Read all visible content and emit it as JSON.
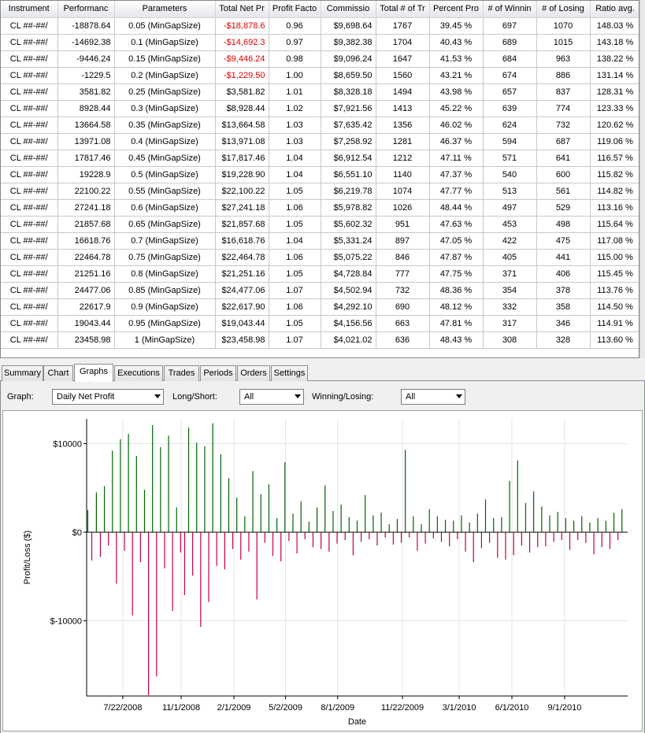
{
  "grid": {
    "columns": [
      "Instrument",
      "Performanc",
      "Parameters",
      "Total Net Pr",
      "Profit Facto",
      "Commissio",
      "Total # of Tr",
      "Percent Pro",
      "# of Winnin",
      "# of Losing",
      "Ratio avg."
    ],
    "rows": [
      [
        "CL ##-##/",
        "-18878.64",
        "0.05 (MinGapSize)",
        "-$18,878.6",
        "0.96",
        "$9,698.64",
        "1767",
        "39.45 %",
        "697",
        "1070",
        "148.03 %"
      ],
      [
        "CL ##-##/",
        "-14692.38",
        "0.1 (MinGapSize)",
        "-$14,692.3",
        "0.97",
        "$9,382.38",
        "1704",
        "40.43 %",
        "689",
        "1015",
        "143.18 %"
      ],
      [
        "CL ##-##/",
        "-9446.24",
        "0.15 (MinGapSize)",
        "-$9,446.24",
        "0.98",
        "$9,096.24",
        "1647",
        "41.53 %",
        "684",
        "963",
        "138.22 %"
      ],
      [
        "CL ##-##/",
        "-1229.5",
        "0.2 (MinGapSize)",
        "-$1,229.50",
        "1.00",
        "$8,659.50",
        "1560",
        "43.21 %",
        "674",
        "886",
        "131.14 %"
      ],
      [
        "CL ##-##/",
        "3581.82",
        "0.25 (MinGapSize)",
        "$3,581.82",
        "1.01",
        "$8,328.18",
        "1494",
        "43.98 %",
        "657",
        "837",
        "128.31 %"
      ],
      [
        "CL ##-##/",
        "8928.44",
        "0.3 (MinGapSize)",
        "$8,928.44",
        "1.02",
        "$7,921.56",
        "1413",
        "45.22 %",
        "639",
        "774",
        "123.33 %"
      ],
      [
        "CL ##-##/",
        "13664.58",
        "0.35 (MinGapSize)",
        "$13,664.58",
        "1.03",
        "$7,635.42",
        "1356",
        "46.02 %",
        "624",
        "732",
        "120.62 %"
      ],
      [
        "CL ##-##/",
        "13971.08",
        "0.4 (MinGapSize)",
        "$13,971.08",
        "1.03",
        "$7,258.92",
        "1281",
        "46.37 %",
        "594",
        "687",
        "119.06 %"
      ],
      [
        "CL ##-##/",
        "17817.46",
        "0.45 (MinGapSize)",
        "$17,817.46",
        "1.04",
        "$6,912.54",
        "1212",
        "47.11 %",
        "571",
        "641",
        "116.57 %"
      ],
      [
        "CL ##-##/",
        "19228.9",
        "0.5 (MinGapSize)",
        "$19,228.90",
        "1.04",
        "$6,551.10",
        "1140",
        "47.37 %",
        "540",
        "600",
        "115.82 %"
      ],
      [
        "CL ##-##/",
        "22100.22",
        "0.55 (MinGapSize)",
        "$22,100.22",
        "1.05",
        "$6,219.78",
        "1074",
        "47.77 %",
        "513",
        "561",
        "114.82 %"
      ],
      [
        "CL ##-##/",
        "27241.18",
        "0.6 (MinGapSize)",
        "$27,241.18",
        "1.06",
        "$5,978.82",
        "1026",
        "48.44 %",
        "497",
        "529",
        "113.16 %"
      ],
      [
        "CL ##-##/",
        "21857.68",
        "0.65 (MinGapSize)",
        "$21,857.68",
        "1.05",
        "$5,602.32",
        "951",
        "47.63 %",
        "453",
        "498",
        "115.64 %"
      ],
      [
        "CL ##-##/",
        "16618.76",
        "0.7 (MinGapSize)",
        "$16,618.76",
        "1.04",
        "$5,331.24",
        "897",
        "47.05 %",
        "422",
        "475",
        "117.08 %"
      ],
      [
        "CL ##-##/",
        "22464.78",
        "0.75 (MinGapSize)",
        "$22,464.78",
        "1.06",
        "$5,075.22",
        "846",
        "47.87 %",
        "405",
        "441",
        "115.00 %"
      ],
      [
        "CL ##-##/",
        "21251.16",
        "0.8 (MinGapSize)",
        "$21,251.16",
        "1.05",
        "$4,728.84",
        "777",
        "47.75 %",
        "371",
        "406",
        "115.45 %"
      ],
      [
        "CL ##-##/",
        "24477.06",
        "0.85 (MinGapSize)",
        "$24,477.06",
        "1.07",
        "$4,502.94",
        "732",
        "48.36 %",
        "354",
        "378",
        "113.76 %"
      ],
      [
        "CL ##-##/",
        "22617.9",
        "0.9 (MinGapSize)",
        "$22,617.90",
        "1.06",
        "$4,292.10",
        "690",
        "48.12 %",
        "332",
        "358",
        "114.50 %"
      ],
      [
        "CL ##-##/",
        "19043.44",
        "0.95 (MinGapSize)",
        "$19,043.44",
        "1.05",
        "$4,156.56",
        "663",
        "47.81 %",
        "317",
        "346",
        "114.91 %"
      ],
      [
        "CL ##-##/",
        "23458.98",
        "1 (MinGapSize)",
        "$23,458.98",
        "1.07",
        "$4,021.02",
        "636",
        "48.43 %",
        "308",
        "328",
        "113.60 %"
      ]
    ]
  },
  "tabs": [
    {
      "label": "Summary",
      "active": false
    },
    {
      "label": "Chart",
      "active": false
    },
    {
      "label": "Graphs",
      "active": true
    },
    {
      "label": "Executions",
      "active": false
    },
    {
      "label": "Trades",
      "active": false
    },
    {
      "label": "Periods",
      "active": false
    },
    {
      "label": "Orders",
      "active": false
    },
    {
      "label": "Settings",
      "active": false
    }
  ],
  "controls": {
    "graph_label": "Graph:",
    "graph_value": "Daily Net Profit",
    "longshort_label": "Long/Short:",
    "longshort_value": "All",
    "winlose_label": "Winning/Losing:",
    "winlose_value": "All"
  },
  "colors": {
    "positive_bar": "#006400",
    "negative_bar": "#c8003c",
    "negative_text": "#e00000",
    "grid_line": "#e4e4e4"
  },
  "chart_data": {
    "type": "bar",
    "title": "",
    "xlabel": "Date",
    "ylabel": "Profit/Loss ($)",
    "ylim": [
      -18500,
      12800
    ],
    "xlim": [
      "2008-05-20",
      "2010-12-20"
    ],
    "yticks": [
      10000,
      0,
      -10000
    ],
    "ytick_labels": [
      "$10000",
      "$0",
      "$-10000"
    ],
    "xticks": [
      "2008-07-22",
      "2008-11-01",
      "2009-02-01",
      "2009-05-02",
      "2009-08-01",
      "2009-11-22",
      "2010-03-01",
      "2010-06-01",
      "2010-09-01"
    ],
    "xtick_labels": [
      "7/22/2008",
      "11/1/2008",
      "2/1/2009",
      "5/2/2009",
      "8/1/2009",
      "11/22/2009",
      "3/1/2010",
      "6/1/2010",
      "9/1/2010"
    ],
    "grid": true,
    "series": [
      {
        "x": [
          "2008-05-22",
          "2008-05-29",
          "2008-06-06",
          "2008-06-13",
          "2008-06-20",
          "2008-06-27",
          "2008-07-04",
          "2008-07-11",
          "2008-07-18",
          "2008-07-25",
          "2008-08-01",
          "2008-08-08",
          "2008-08-15",
          "2008-08-22",
          "2008-08-29",
          "2008-09-05",
          "2008-09-12",
          "2008-09-19",
          "2008-09-26",
          "2008-10-03",
          "2008-10-10",
          "2008-10-17",
          "2008-10-24",
          "2008-10-31",
          "2008-11-07",
          "2008-11-14",
          "2008-11-21",
          "2008-11-28",
          "2008-12-05",
          "2008-12-12",
          "2008-12-19",
          "2008-12-26",
          "2009-01-02",
          "2009-01-09",
          "2009-01-16",
          "2009-01-23",
          "2009-01-30",
          "2009-02-06",
          "2009-02-13",
          "2009-02-20",
          "2009-02-27",
          "2009-03-06",
          "2009-03-13",
          "2009-03-20",
          "2009-03-27",
          "2009-04-03",
          "2009-04-10",
          "2009-04-17",
          "2009-04-24",
          "2009-05-01",
          "2009-05-08",
          "2009-05-15",
          "2009-05-22",
          "2009-05-29",
          "2009-06-05",
          "2009-06-12",
          "2009-06-19",
          "2009-06-26",
          "2009-07-03",
          "2009-07-10",
          "2009-07-17",
          "2009-07-24",
          "2009-07-31",
          "2009-08-07",
          "2009-08-14",
          "2009-08-21",
          "2009-08-28",
          "2009-09-04",
          "2009-09-11",
          "2009-09-18",
          "2009-09-25",
          "2009-10-02",
          "2009-10-09",
          "2009-10-16",
          "2009-10-23",
          "2009-10-30",
          "2009-11-06",
          "2009-11-13",
          "2009-11-20",
          "2009-11-27",
          "2009-12-04",
          "2009-12-11",
          "2009-12-18",
          "2009-12-25",
          "2010-01-01",
          "2010-01-08",
          "2010-01-15",
          "2010-01-22",
          "2010-01-29",
          "2010-02-05",
          "2010-02-12",
          "2010-02-19",
          "2010-02-26",
          "2010-03-05",
          "2010-03-12",
          "2010-03-19",
          "2010-03-26",
          "2010-04-02",
          "2010-04-09",
          "2010-04-16",
          "2010-04-23",
          "2010-04-30",
          "2010-05-07",
          "2010-05-14",
          "2010-05-21",
          "2010-05-28",
          "2010-06-04",
          "2010-06-11",
          "2010-06-18",
          "2010-06-25",
          "2010-07-02",
          "2010-07-09",
          "2010-07-16",
          "2010-07-23",
          "2010-07-30",
          "2010-08-06",
          "2010-08-13",
          "2010-08-20",
          "2010-08-27",
          "2010-09-03",
          "2010-09-10",
          "2010-09-17",
          "2010-09-24",
          "2010-10-01",
          "2010-10-08",
          "2010-10-15",
          "2010-10-22",
          "2010-10-29",
          "2010-11-05",
          "2010-11-12",
          "2010-11-19",
          "2010-11-26",
          "2010-12-03",
          "2010-12-10"
        ],
        "values": [
          2500,
          -3200,
          4500,
          -2800,
          5200,
          -1500,
          9200,
          -5800,
          10500,
          -2100,
          11100,
          -9400,
          8600,
          -3400,
          4800,
          -18400,
          12100,
          -16300,
          9600,
          -4100,
          10900,
          -8900,
          2800,
          -2300,
          -7100,
          11800,
          -4900,
          10100,
          -10700,
          9700,
          -7900,
          12300,
          -3800,
          8800,
          -4200,
          6100,
          -1900,
          3900,
          -3100,
          1800,
          -2200,
          6900,
          -7600,
          4300,
          -1200,
          5400,
          -2700,
          1600,
          -3300,
          7900,
          -1000,
          2100,
          -2400,
          3500,
          -800,
          1200,
          -1700,
          2800,
          -1900,
          5300,
          -2200,
          2400,
          -1300,
          3100,
          -900,
          1700,
          -2600,
          1300,
          -1100,
          4200,
          -800,
          1900,
          -1500,
          2200,
          -600,
          900,
          -1400,
          1500,
          -1200,
          9300,
          -600,
          1800,
          -2100,
          900,
          -1300,
          2600,
          -700,
          1800,
          -1100,
          1400,
          -1600,
          1300,
          -800,
          1900,
          -2200,
          1100,
          -3400,
          2100,
          -1800,
          3700,
          -1200,
          1600,
          -2900,
          1700,
          -3100,
          5800,
          -2600,
          8100,
          -1500,
          3300,
          -2300,
          4600,
          -1700,
          2900,
          -1600,
          1900,
          -1100,
          2300,
          -900,
          1600,
          -2000,
          1300,
          -900,
          1800,
          -1200,
          1100,
          -2500,
          1600,
          -1700,
          1300,
          -1900,
          2200,
          -900,
          2600
        ]
      }
    ]
  }
}
